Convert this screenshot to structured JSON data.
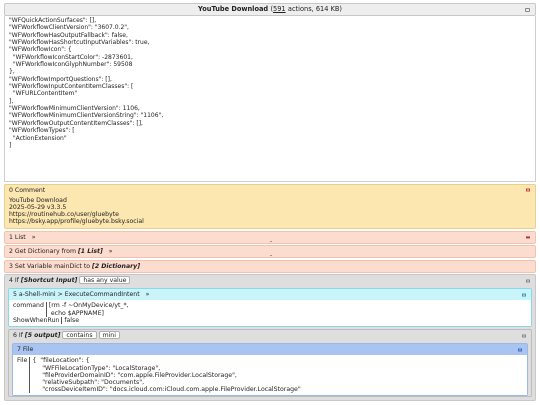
{
  "window": {
    "title_main": "YouTube Download",
    "title_count_link": "591",
    "title_suffix": "actions, 614 KB)"
  },
  "meta_lines": [
    "\"WFQuickActionSurfaces\": [],",
    "\"WFWorkflowClientVersion\": \"3607.0.2\",",
    "\"WFWorkflowHasOutputFallback\": false,",
    "\"WFWorkflowHasShortcutInputVariables\": true,",
    "\"WFWorkflowIcon\": {",
    "  \"WFWorkflowIconStartColor\": -2873601,",
    "  \"WFWorkflowIconGlyphNumber\": 59508",
    "},",
    "\"WFWorkflowImportQuestions\": [],",
    "\"WFWorkflowInputContentItemClasses\": [",
    "  \"WFURLContentItem\"",
    "],",
    "\"WFWorkflowMinimumClientVersion\": 1106,",
    "\"WFWorkflowMinimumClientVersionString\": \"1106\",",
    "\"WFWorkflowOutputContentItemClasses\": [],",
    "\"WFWorkflowTypes\": [",
    "  \"ActionExtension\"",
    "]"
  ],
  "actions": {
    "comment": {
      "head": "0 Comment",
      "lines": [
        "YouTube Download",
        "2025-05-29   v3.3.5",
        "https://routinehub.co/user/gluebyte",
        "https://bsky.app/profile/gluebyte.bsky.social"
      ]
    },
    "list": {
      "head": "1 List",
      "arrow": "»"
    },
    "get_dict": {
      "head": "2 Get Dictionary from",
      "var": "[1 List]",
      "arrow": "»"
    },
    "set_var": {
      "head": "3 Set Variable",
      "name": "mainDict",
      "to": "to",
      "var": "[2 Dictionary]"
    },
    "if4": {
      "head": "4 If",
      "var": "[Shortcut Input]",
      "cond": "has any value"
    },
    "shell": {
      "head": "5 a-Shell-mini > ExecuteCommandIntent",
      "arrow": "»",
      "command_label": "command",
      "command_value": "[rm -f ~OnMyDevice/yt_*,\n echo $APPNAME]",
      "show_label": "ShowWhenRun",
      "show_value": "false"
    },
    "if6": {
      "head": "6 If",
      "var": "[5 output]",
      "cond": "contains",
      "value": "mini"
    },
    "file": {
      "head": "7 File",
      "label": "File",
      "value": "{  \"fileLocation\": {\n     \"WFFileLocationType\": \"LocalStorage\",\n     \"fileProviderDomainID\": \"com.apple.FileProvider.LocalStorage\",\n     \"relativeSubpath\": \"Documents\",\n     \"crossDeviceItemID\": \"docs.icloud.com:iCloud.com.apple.FileProvider.LocalStorage\""
    }
  },
  "colors": {
    "comment_bg": "#fde7b0",
    "salmon_bg": "#fcdcce",
    "gray_bg": "#dedede",
    "cyan_bg": "#c8f4fa",
    "blue_bg": "#a9c4f1"
  }
}
